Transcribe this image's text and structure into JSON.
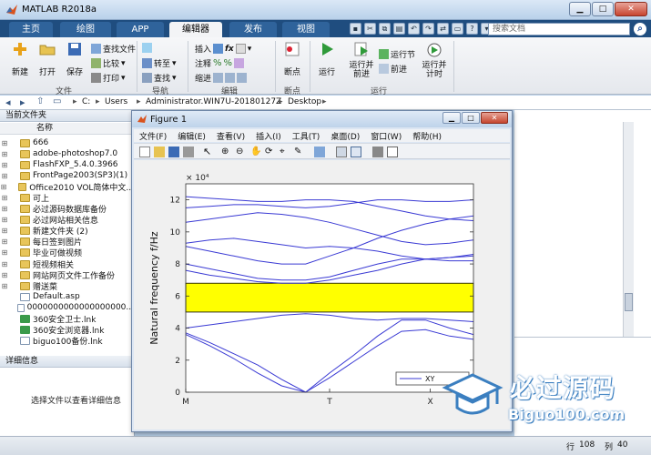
{
  "window": {
    "title": "MATLAB R2018a"
  },
  "tabs": [
    "主页",
    "绘图",
    "APP",
    "编辑器",
    "发布",
    "视图"
  ],
  "search": {
    "placeholder": "搜索文档"
  },
  "ribbon": {
    "new_label": "新建",
    "open_label": "打开",
    "save_label": "保存",
    "find_files_label": "查找文件",
    "compare_label": "比较",
    "print_label": "打印",
    "insert_label": "插入",
    "fx_label": "fx",
    "goto_label": "转至",
    "comment_label": "注释",
    "find_label": "查找",
    "indent_label": "缩进",
    "breakpoint_label": "断点",
    "run_label": "运行",
    "run_advance_label": "运行并\n前进",
    "run_section_label": "运行节",
    "advance_label": "前进",
    "run_time_label": "运行并\n计时",
    "groups": [
      "文件",
      "导航",
      "编辑",
      "断点",
      "运行"
    ]
  },
  "path": [
    "C:",
    "Users",
    "Administrator.WIN7U-20180127Z",
    "Desktop"
  ],
  "left_panel": {
    "title": "当前文件夹",
    "column": "名称",
    "files": [
      {
        "name": "666",
        "type": "folder"
      },
      {
        "name": "adobe-photoshop7.0",
        "type": "folder"
      },
      {
        "name": "FlashFXP_5.4.0.3966",
        "type": "folder"
      },
      {
        "name": "FrontPage2003(SP3)(1)",
        "type": "folder"
      },
      {
        "name": "Office2010 VOL简体中文...",
        "type": "folder"
      },
      {
        "name": "可上",
        "type": "folder"
      },
      {
        "name": "必过源码数据库备份",
        "type": "folder"
      },
      {
        "name": "必过网站相关信息",
        "type": "folder"
      },
      {
        "name": "新建文件夹 (2)",
        "type": "folder"
      },
      {
        "name": "每日签到图片",
        "type": "folder"
      },
      {
        "name": "毕业可做视频",
        "type": "folder"
      },
      {
        "name": "短视频相关",
        "type": "folder"
      },
      {
        "name": "网站网页文件工作备份",
        "type": "folder"
      },
      {
        "name": "赠送菜",
        "type": "folder"
      },
      {
        "name": "Default.asp",
        "type": "doc"
      },
      {
        "name": "0000000000000000000...",
        "type": "doc"
      },
      {
        "name": "360安全卫士.lnk",
        "type": "exe"
      },
      {
        "name": "360安全浏览器.lnk",
        "type": "exe"
      },
      {
        "name": "biguo100备份.lnk",
        "type": "doc"
      }
    ]
  },
  "detail_panel": {
    "title": "详细信息",
    "message": "选择文件以查看详细信息"
  },
  "status": {
    "row_label": "行",
    "row": "108",
    "col_label": "列",
    "col": "40"
  },
  "figure": {
    "title": "Figure 1",
    "menu": [
      "文件(F)",
      "编辑(E)",
      "查看(V)",
      "插入(I)",
      "工具(T)",
      "桌面(D)",
      "窗口(W)",
      "帮助(H)"
    ]
  },
  "chart_data": {
    "type": "line",
    "ylabel": "Natural frequency f/Hz",
    "xlabel": "",
    "y_multiplier": "× 10⁴",
    "ylim": [
      0,
      13
    ],
    "yticks": [
      "0",
      "2",
      "4",
      "6",
      "8",
      "10",
      "12"
    ],
    "xticks": [
      "M",
      "T",
      "X"
    ],
    "legend": [
      "XY"
    ],
    "legend_placement": "bottom-right",
    "band_gap": {
      "from": 5.0,
      "to": 6.8,
      "color": "#ffff00"
    },
    "line_color": "#3a3ad4",
    "x": [
      0,
      1,
      2,
      3,
      4,
      5,
      6,
      7,
      8,
      9,
      10,
      11,
      12
    ],
    "series": [
      {
        "values": [
          3.6,
          2.9,
          2.1,
          1.2,
          0.4,
          0.0,
          0.9,
          1.9,
          2.9,
          3.8,
          3.9,
          3.5,
          3.3
        ]
      },
      {
        "values": [
          3.7,
          3.1,
          2.4,
          1.7,
          0.8,
          0.0,
          1.2,
          2.3,
          3.5,
          4.5,
          4.5,
          4.0,
          3.6
        ]
      },
      {
        "values": [
          4.0,
          4.2,
          4.4,
          4.6,
          4.8,
          4.9,
          4.8,
          4.6,
          4.5,
          4.6,
          4.6,
          4.5,
          4.4
        ]
      },
      {
        "values": [
          7.6,
          7.3,
          7.1,
          6.9,
          6.8,
          6.8,
          7.0,
          7.3,
          7.6,
          8.0,
          8.3,
          8.2,
          8.2
        ]
      },
      {
        "values": [
          8.0,
          7.7,
          7.4,
          7.1,
          7.0,
          7.0,
          7.2,
          7.6,
          8.0,
          8.3,
          8.3,
          8.4,
          8.6
        ]
      },
      {
        "values": [
          9.1,
          8.8,
          8.5,
          8.2,
          8.0,
          8.0,
          8.5,
          9.0,
          9.6,
          10.1,
          10.5,
          10.8,
          11.0
        ]
      },
      {
        "values": [
          9.3,
          9.5,
          9.6,
          9.4,
          9.2,
          9.0,
          9.1,
          9.0,
          8.8,
          8.5,
          8.3,
          8.4,
          8.5
        ]
      },
      {
        "values": [
          10.6,
          10.8,
          11.0,
          11.2,
          11.1,
          10.9,
          10.6,
          10.2,
          9.8,
          9.4,
          9.2,
          9.3,
          9.5
        ]
      },
      {
        "values": [
          11.5,
          11.6,
          11.7,
          11.7,
          11.6,
          11.5,
          11.6,
          11.8,
          12.0,
          12.0,
          11.9,
          11.9,
          12.0
        ]
      },
      {
        "values": [
          12.2,
          12.1,
          12.0,
          11.9,
          11.9,
          12.0,
          12.0,
          11.9,
          11.6,
          11.3,
          11.0,
          10.8,
          10.7
        ]
      }
    ]
  },
  "watermark": {
    "text": "必过源码",
    "url": "Biguo100.com"
  }
}
